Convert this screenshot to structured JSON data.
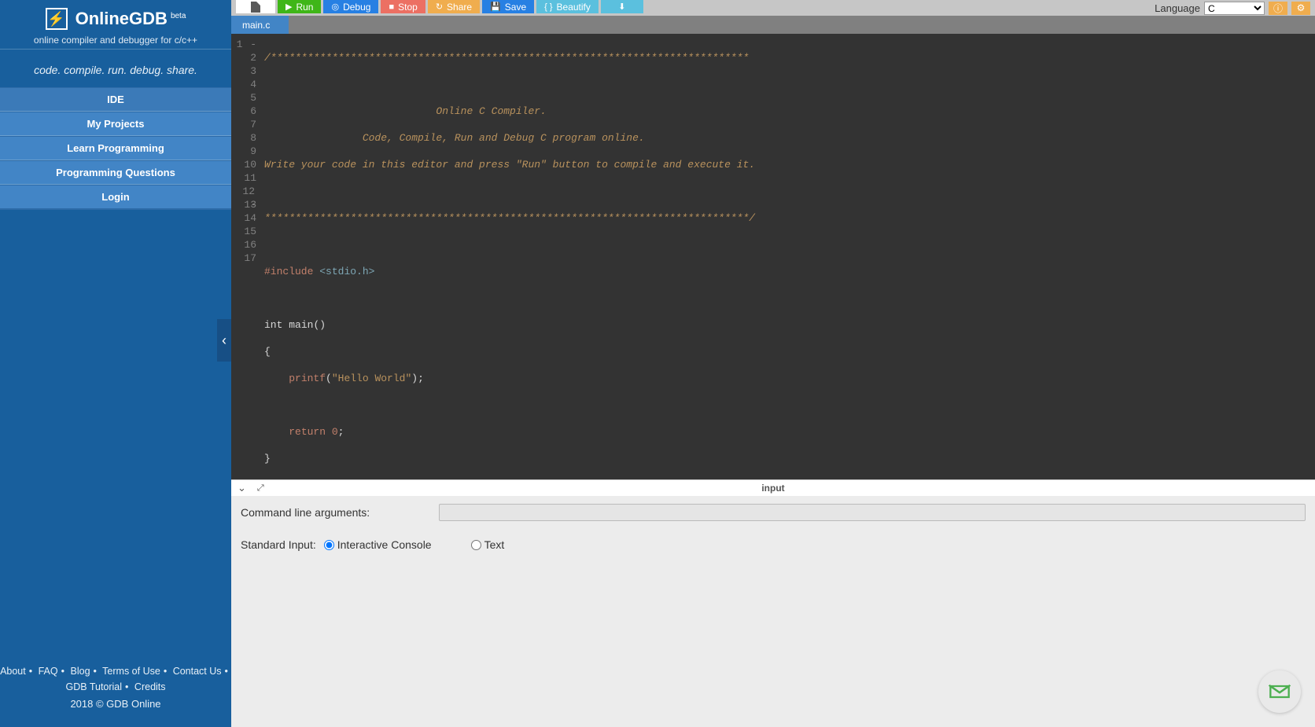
{
  "sidebar": {
    "brand_title": "OnlineGDB",
    "brand_beta": "beta",
    "brand_subtitle": "online compiler and debugger for c/c++",
    "tagline": "code. compile. run. debug. share.",
    "nav": [
      "IDE",
      "My Projects",
      "Learn Programming",
      "Programming Questions",
      "Login"
    ],
    "footer_links_1": [
      "About",
      "FAQ",
      "Blog",
      "Terms of Use",
      "Contact Us",
      "GDB Tutorial",
      "Credits"
    ],
    "copyright": "2018 © GDB Online"
  },
  "toolbar": {
    "run": "Run",
    "debug": "Debug",
    "stop": "Stop",
    "share": "Share",
    "save": "Save",
    "beautify": "Beautify",
    "language_label": "Language",
    "language_value": "C"
  },
  "tabs": {
    "active": "main.c"
  },
  "code": {
    "lines": [
      "/******************************************************************************",
      "",
      "                            Online C Compiler.",
      "                Code, Compile, Run and Debug C program online.",
      "Write your code in this editor and press \"Run\" button to compile and execute it.",
      "",
      "*******************************************************************************/",
      "",
      "#include <stdio.h>",
      "",
      "int main()",
      "{",
      "    printf(\"Hello World\");",
      "",
      "    return 0;",
      "}",
      ""
    ]
  },
  "panel": {
    "title": "input",
    "cli_label": "Command line arguments:",
    "cli_value": "",
    "stdin_label": "Standard Input:",
    "opt_interactive": "Interactive Console",
    "opt_text": "Text",
    "selected": "interactive"
  }
}
